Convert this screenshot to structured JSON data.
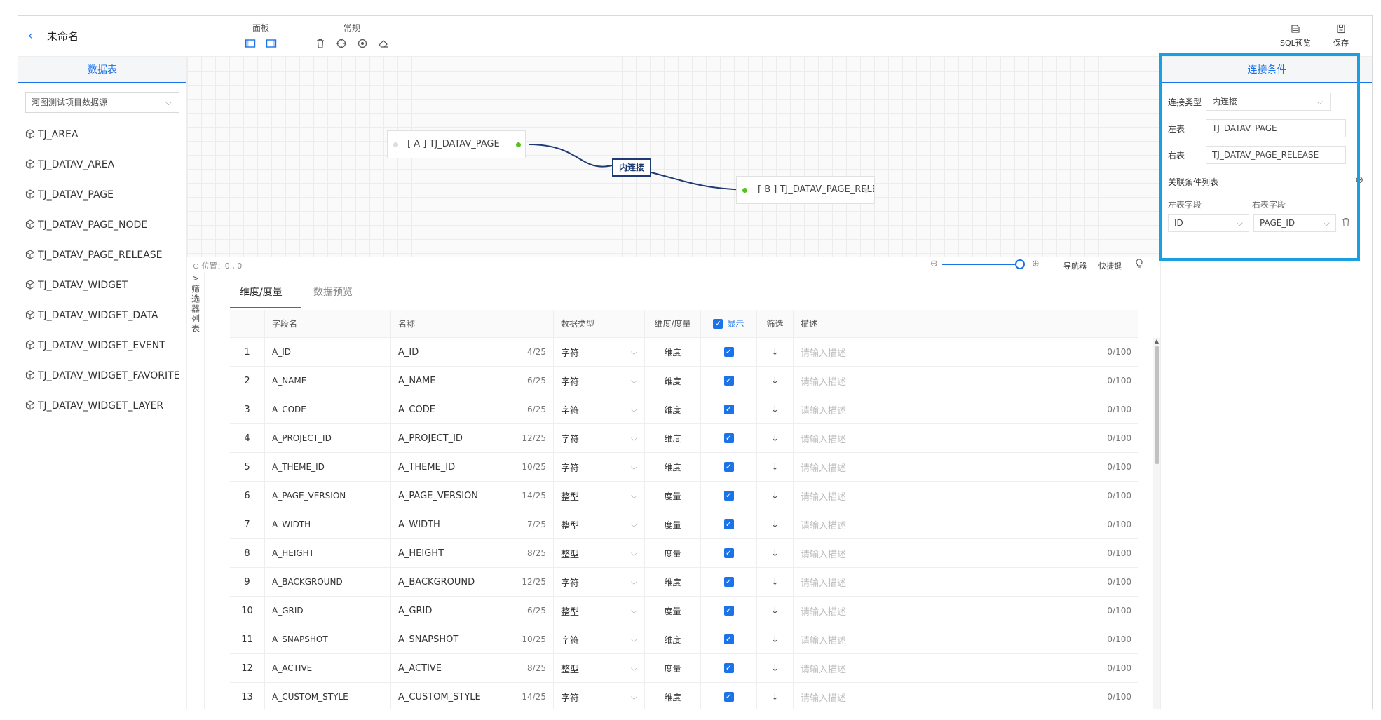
{
  "header": {
    "back_icon": "‹",
    "title": "未命名",
    "panel_label": "面板",
    "common_label": "常规",
    "sql_preview_label": "SQL预览",
    "save_label": "保存"
  },
  "left": {
    "tab_label": "数据表",
    "datasource": "河图测试项目数据源",
    "tables": [
      "TJ_AREA",
      "TJ_DATAV_AREA",
      "TJ_DATAV_PAGE",
      "TJ_DATAV_PAGE_NODE",
      "TJ_DATAV_PAGE_RELEASE",
      "TJ_DATAV_WIDGET",
      "TJ_DATAV_WIDGET_DATA",
      "TJ_DATAV_WIDGET_EVENT",
      "TJ_DATAV_WIDGET_FAVORITE",
      "TJ_DATAV_WIDGET_LAYER"
    ]
  },
  "canvas": {
    "node_a": "[ A ] TJ_DATAV_PAGE",
    "node_b": "[ B ] TJ_DATAV_PAGE_RELEASE",
    "join_label": "内连接"
  },
  "status": {
    "position": "位置：0 , 0",
    "navigator": "导航器",
    "shortcut": "快捷键"
  },
  "filter_panel": {
    "chevron": ">",
    "label": "筛选器列表"
  },
  "bottom": {
    "tabs": [
      "维度/度量",
      "数据预览"
    ],
    "headers": {
      "field": "字段名",
      "name": "名称",
      "type": "数据类型",
      "dim": "维度/度量",
      "show": "显示",
      "filter": "筛选",
      "desc": "描述"
    },
    "desc_placeholder": "请输入描述",
    "desc_count": "0/100",
    "rows": [
      {
        "idx": "1",
        "field": "A_ID",
        "name": "A_ID",
        "count": "4/25",
        "type": "字符",
        "dim": "维度"
      },
      {
        "idx": "2",
        "field": "A_NAME",
        "name": "A_NAME",
        "count": "6/25",
        "type": "字符",
        "dim": "维度"
      },
      {
        "idx": "3",
        "field": "A_CODE",
        "name": "A_CODE",
        "count": "6/25",
        "type": "字符",
        "dim": "维度"
      },
      {
        "idx": "4",
        "field": "A_PROJECT_ID",
        "name": "A_PROJECT_ID",
        "count": "12/25",
        "type": "字符",
        "dim": "维度"
      },
      {
        "idx": "5",
        "field": "A_THEME_ID",
        "name": "A_THEME_ID",
        "count": "10/25",
        "type": "字符",
        "dim": "维度"
      },
      {
        "idx": "6",
        "field": "A_PAGE_VERSION",
        "name": "A_PAGE_VERSION",
        "count": "14/25",
        "type": "整型",
        "dim": "度量"
      },
      {
        "idx": "7",
        "field": "A_WIDTH",
        "name": "A_WIDTH",
        "count": "7/25",
        "type": "整型",
        "dim": "度量"
      },
      {
        "idx": "8",
        "field": "A_HEIGHT",
        "name": "A_HEIGHT",
        "count": "8/25",
        "type": "整型",
        "dim": "度量"
      },
      {
        "idx": "9",
        "field": "A_BACKGROUND",
        "name": "A_BACKGROUND",
        "count": "12/25",
        "type": "字符",
        "dim": "维度"
      },
      {
        "idx": "10",
        "field": "A_GRID",
        "name": "A_GRID",
        "count": "6/25",
        "type": "整型",
        "dim": "度量"
      },
      {
        "idx": "11",
        "field": "A_SNAPSHOT",
        "name": "A_SNAPSHOT",
        "count": "10/25",
        "type": "字符",
        "dim": "维度"
      },
      {
        "idx": "12",
        "field": "A_ACTIVE",
        "name": "A_ACTIVE",
        "count": "8/25",
        "type": "整型",
        "dim": "度量"
      },
      {
        "idx": "13",
        "field": "A_CUSTOM_STYLE",
        "name": "A_CUSTOM_STYLE",
        "count": "14/25",
        "type": "字符",
        "dim": "维度"
      }
    ]
  },
  "right": {
    "title": "连接条件",
    "join_type_label": "连接类型",
    "join_type_value": "内连接",
    "left_table_label": "左表",
    "left_table_value": "TJ_DATAV_PAGE",
    "right_table_label": "右表",
    "right_table_value": "TJ_DATAV_PAGE_RELEASE",
    "cond_list_label": "关联条件列表",
    "left_field_label": "左表字段",
    "right_field_label": "右表字段",
    "left_field_value": "ID",
    "right_field_value": "PAGE_ID"
  },
  "colors": {
    "accent": "#1a73e8",
    "highlight_border": "#1a9fe0",
    "join_line": "#1f3b73",
    "node_dot_green": "#52c41a"
  }
}
